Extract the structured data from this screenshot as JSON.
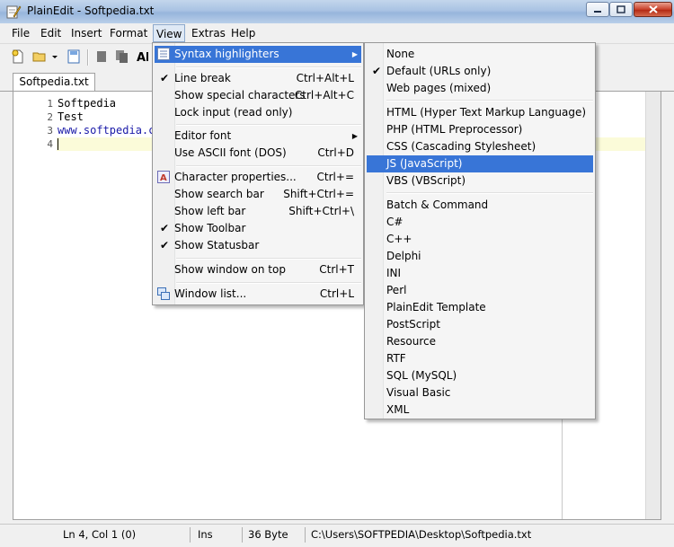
{
  "window": {
    "title": "PlainEdit - Softpedia.txt"
  },
  "menubar": {
    "items": [
      "File",
      "Edit",
      "Insert",
      "Format",
      "View",
      "Extras",
      "Help"
    ]
  },
  "tab": {
    "label": "Softpedia.txt"
  },
  "editor": {
    "line_numbers": [
      "1",
      "2",
      "3",
      "4"
    ],
    "lines": [
      "Softpedia",
      "Test",
      "www.softpedia.c",
      ""
    ]
  },
  "statusbar": {
    "position": "Ln 4, Col 1 (0)",
    "mode": "Ins",
    "size": "36 Byte",
    "path": "C:\\Users\\SOFTPEDIA\\Desktop\\Softpedia.txt"
  },
  "view_menu": {
    "items": [
      {
        "label": "Syntax highlighters",
        "shortcut": ""
      },
      {
        "label": "Line break",
        "shortcut": "Ctrl+Alt+L"
      },
      {
        "label": "Show special characters",
        "shortcut": "Ctrl+Alt+C"
      },
      {
        "label": "Lock input (read only)",
        "shortcut": ""
      },
      {
        "label": "Editor font",
        "shortcut": ""
      },
      {
        "label": "Use ASCII font (DOS)",
        "shortcut": "Ctrl+D"
      },
      {
        "label": "Character properties...",
        "shortcut": "Ctrl+="
      },
      {
        "label": "Show search bar",
        "shortcut": "Shift+Ctrl+="
      },
      {
        "label": "Show left bar",
        "shortcut": "Shift+Ctrl+\\"
      },
      {
        "label": "Show Toolbar",
        "shortcut": ""
      },
      {
        "label": "Show Statusbar",
        "shortcut": ""
      },
      {
        "label": "Show window on top",
        "shortcut": "Ctrl+T"
      },
      {
        "label": "Window list...",
        "shortcut": "Ctrl+L"
      }
    ]
  },
  "syntax_menu": {
    "items": [
      "None",
      "Default (URLs only)",
      "Web pages (mixed)",
      "HTML (Hyper Text Markup Language)",
      "PHP (HTML Preprocessor)",
      "CSS (Cascading Stylesheet)",
      "JS (JavaScript)",
      "VBS (VBScript)",
      "Batch & Command",
      "C#",
      "C++",
      "Delphi",
      "INI",
      "Perl",
      "PlainEdit Template",
      "PostScript",
      "Resource",
      "RTF",
      "SQL (MySQL)",
      "Visual Basic",
      "XML"
    ]
  },
  "colors": {
    "highlight": "#3875d7",
    "current_line": "#fbfbd9",
    "link": "#1a1aa8"
  }
}
